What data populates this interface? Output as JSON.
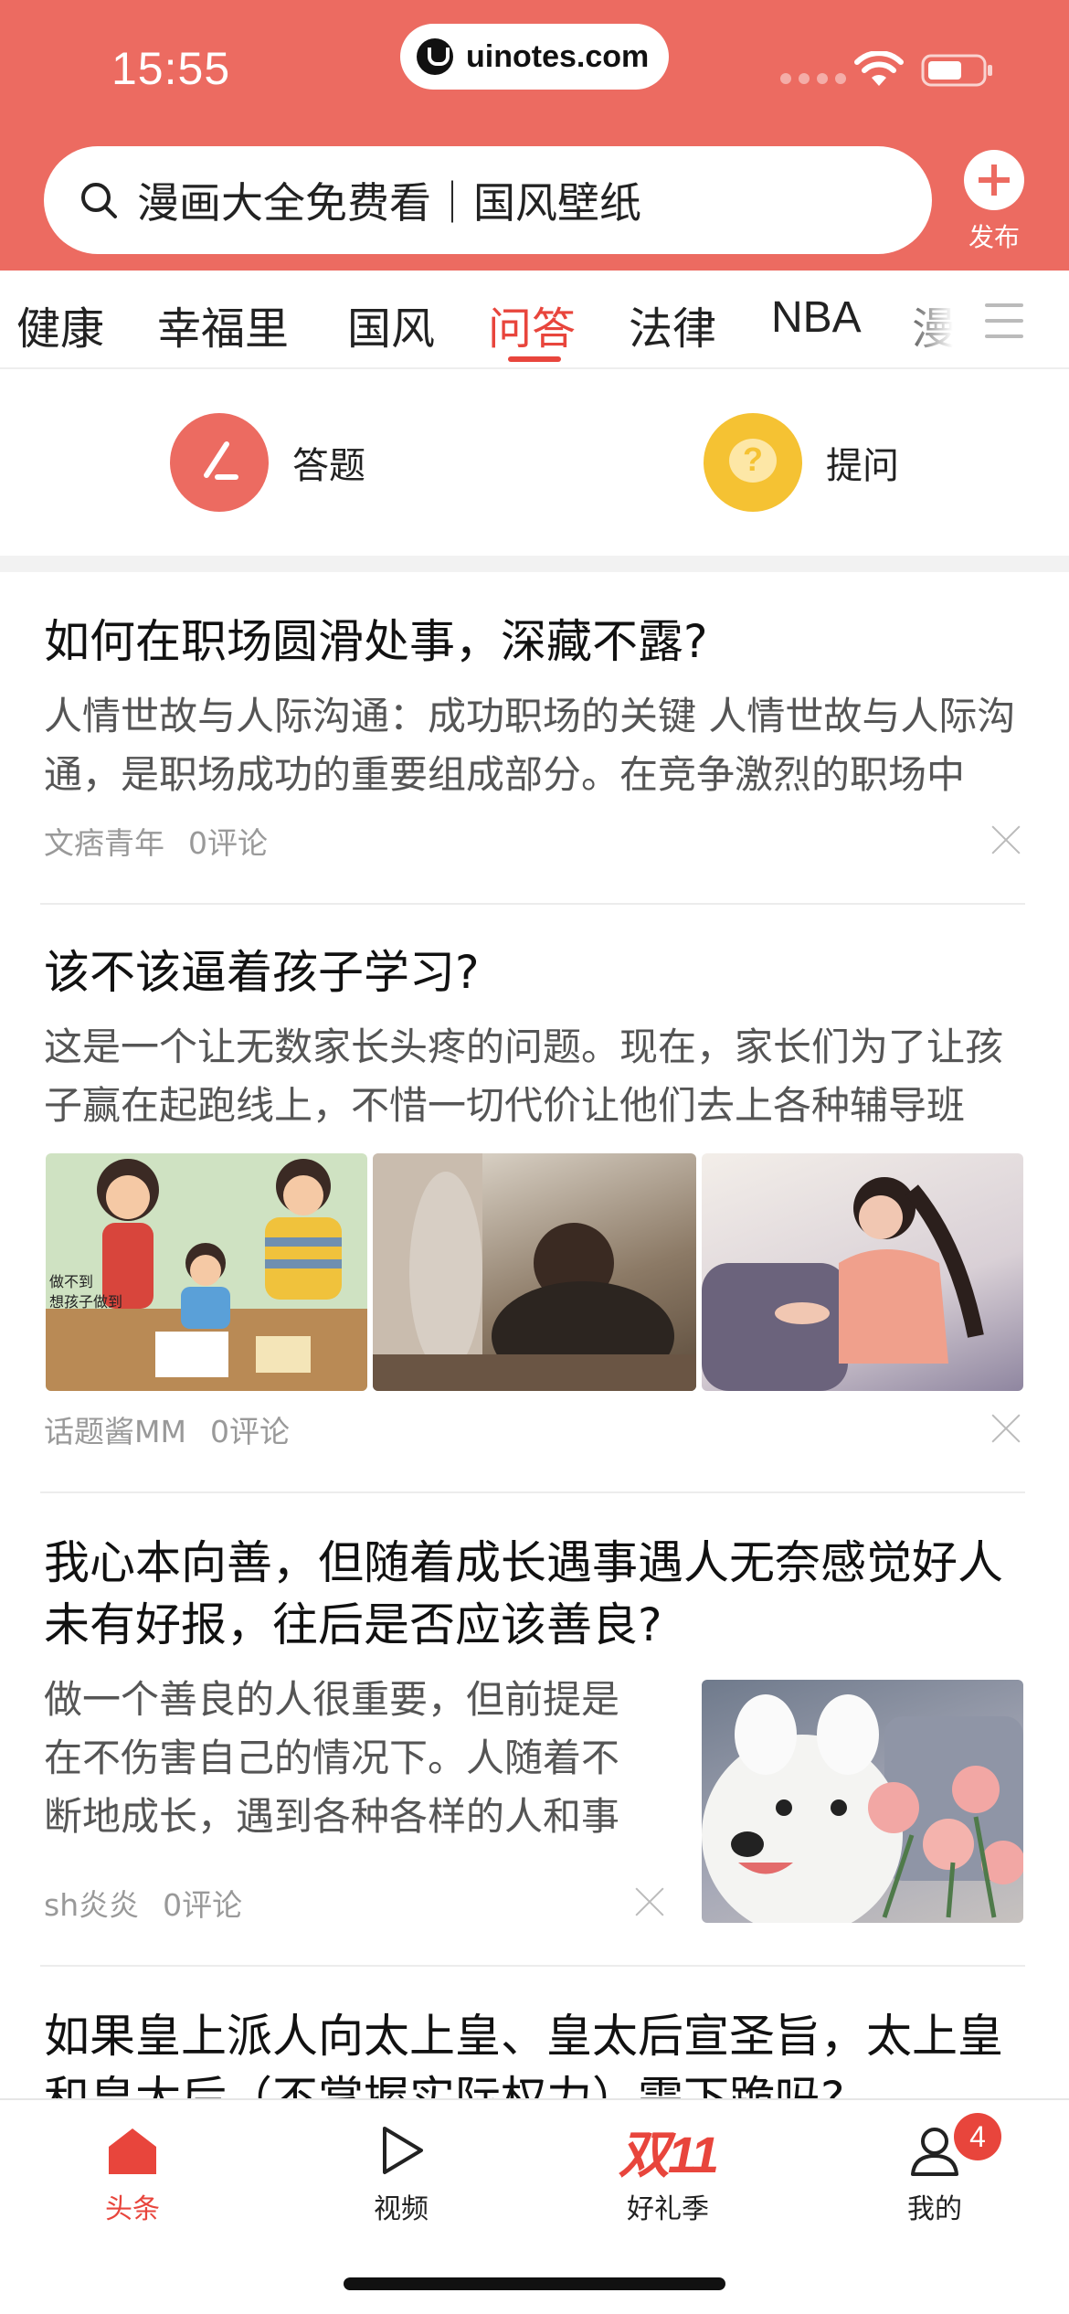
{
  "status_bar": {
    "time": "15:55",
    "url": "uinotes.com"
  },
  "header": {
    "search_text": "漫画大全免费看｜国风壁纸",
    "publish_label": "发布"
  },
  "tabs": [
    "健康",
    "幸福里",
    "国风",
    "问答",
    "法律",
    "NBA",
    "漫"
  ],
  "active_tab": "问答",
  "qa_actions": {
    "answer": "答题",
    "ask": "提问",
    "ask_glyph": "?"
  },
  "articles": [
    {
      "title": "如何在职场圆滑处事，深藏不露?",
      "summary": "人情世故与人际沟通：成功职场的关键 人情世故与人际沟通，是职场成功的重要组成部分。在竞争激烈的职场中",
      "author": "文痞青年",
      "comments": "0评论"
    },
    {
      "title": "该不该逼着孩子学习?",
      "summary": "这是一个让无数家长头疼的问题。现在，家长们为了让孩子赢在起跑线上，不惜一切代价让他们去上各种辅导班",
      "author": "话题酱MM",
      "comments": "0评论",
      "cartoon_text": "做不到\n想孩子做到"
    },
    {
      "title": "我心本向善，但随着成长遇事遇人无奈感觉好人未有好报，往后是否应该善良?",
      "summary": "做一个善良的人很重要，但前提是在不伤害自己的情况下。人随着不断地成长，遇到各种各样的人和事",
      "author": "sh炎炎",
      "comments": "0评论"
    },
    {
      "title": "如果皇上派人向太上皇、皇太后宣圣旨，太上皇和皇太后（不掌握实际权力）需下跪吗?"
    }
  ],
  "bottom_nav": {
    "items": [
      "头条",
      "视频",
      "好礼季",
      "我的"
    ],
    "promo_logo": "双11",
    "badge_count": "4"
  },
  "colors": {
    "brand": "#ec6b61",
    "accent": "#e8453c",
    "ask_yellow": "#f5c233"
  }
}
